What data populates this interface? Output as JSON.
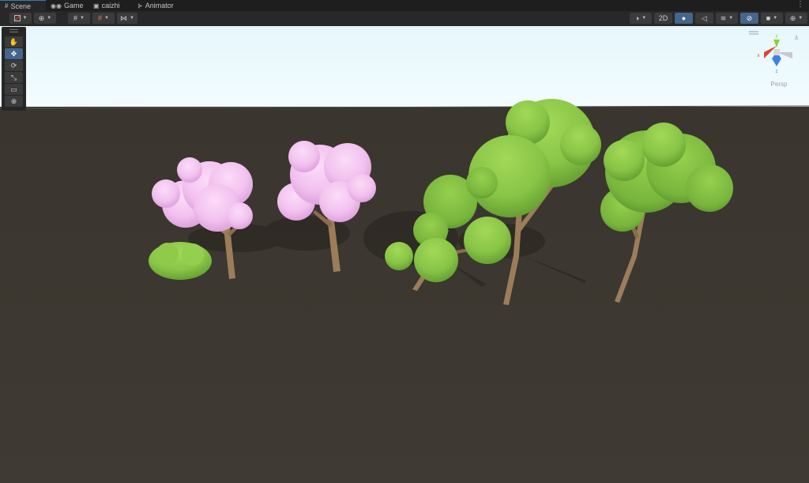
{
  "tabs": {
    "scene": {
      "label": "Scene",
      "icon": "grid-icon"
    },
    "game": {
      "label": "Game",
      "icon": "gamepad-icon"
    },
    "caizhi": {
      "label": "caizhi",
      "icon": "asset-icon"
    },
    "animator": {
      "label": "Animator",
      "icon": "animator-icon"
    },
    "menu_glyph": "⋮"
  },
  "toolbar": {
    "two_d_label": "2D",
    "lighting_active": true,
    "scene_visibility_active": true
  },
  "tools": [
    {
      "name": "hand-tool",
      "icon": "hand-icon",
      "glyph": "✋",
      "active": false
    },
    {
      "name": "move-tool",
      "icon": "move-icon",
      "glyph": "✥",
      "active": true
    },
    {
      "name": "rotate-tool",
      "icon": "rotate-icon",
      "glyph": "⟳",
      "active": false
    },
    {
      "name": "scale-tool",
      "icon": "scale-icon",
      "glyph": "⤡",
      "active": false
    },
    {
      "name": "rect-tool",
      "icon": "rect-icon",
      "glyph": "▭",
      "active": false
    },
    {
      "name": "transform-tool",
      "icon": "transform-icon",
      "glyph": "⊕",
      "active": false
    }
  ],
  "gizmo": {
    "label": "Persp",
    "axis_colors": {
      "x": "#e0452f",
      "y": "#8bd12f",
      "z": "#3f82e3"
    }
  },
  "colors": {
    "active_tab_accent": "#3a79bb",
    "active_button": "#44658c",
    "sky": "#eefafe",
    "ground": "#3d3831",
    "blossom": "#f2c4ef",
    "foliage": "#8dc64a"
  }
}
